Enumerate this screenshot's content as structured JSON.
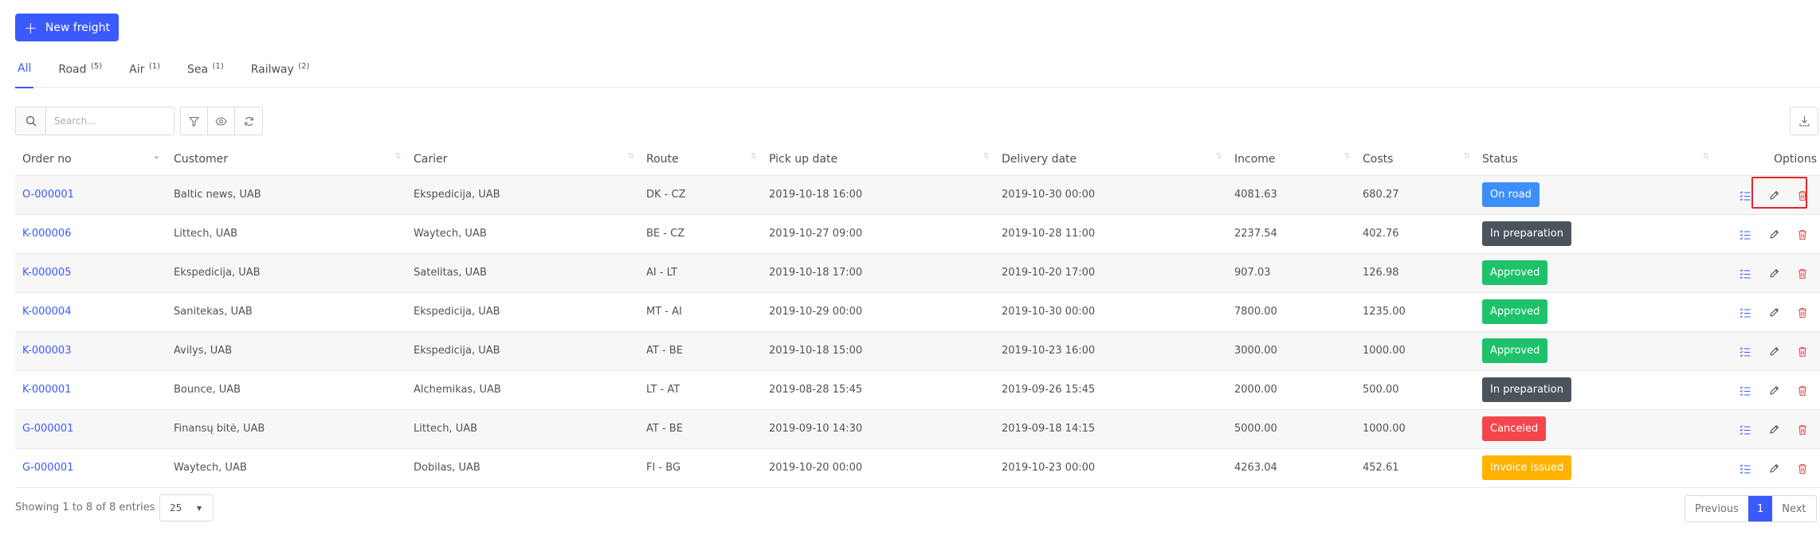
{
  "new_button": {
    "label": "New freight"
  },
  "tabs": [
    {
      "label": "All",
      "count": ""
    },
    {
      "label": "Road",
      "count": "(5)"
    },
    {
      "label": "Air",
      "count": "(1)"
    },
    {
      "label": "Sea",
      "count": "(1)"
    },
    {
      "label": "Railway",
      "count": "(2)"
    }
  ],
  "active_tab": "All",
  "search": {
    "placeholder": "Search...",
    "value": ""
  },
  "toolbar_icons": [
    "filter-icon",
    "eye-icon",
    "refresh-icon",
    "download-icon"
  ],
  "columns": [
    "Order no",
    "Customer",
    "Carier",
    "Route",
    "Pick up date",
    "Delivery date",
    "Income",
    "Costs",
    "Status",
    "Options"
  ],
  "rows": [
    {
      "order": "O-000001",
      "customer": "Baltic news, UAB",
      "carrier": "Ekspedicija, UAB",
      "route": "DK - CZ",
      "pickup": "2019-10-18 16:00",
      "delivery": "2019-10-30 00:00",
      "income": "4081.63",
      "costs": "680.27",
      "status": "On road",
      "status_color": "#3d8ef8"
    },
    {
      "order": "K-000006",
      "customer": "Littech, UAB",
      "carrier": "Waytech, UAB",
      "route": "BE - CZ",
      "pickup": "2019-10-27 09:00",
      "delivery": "2019-10-28 11:00",
      "income": "2237.54",
      "costs": "402.76",
      "status": "In preparation",
      "status_color": "#4b545c"
    },
    {
      "order": "K-000005",
      "customer": "Ekspedicija, UAB",
      "carrier": "Satelitas, UAB",
      "route": "AI - LT",
      "pickup": "2019-10-18 17:00",
      "delivery": "2019-10-20 17:00",
      "income": "907.03",
      "costs": "126.98",
      "status": "Approved",
      "status_color": "#1ec26a"
    },
    {
      "order": "K-000004",
      "customer": "Sanitekas, UAB",
      "carrier": "Ekspedicija, UAB",
      "route": "MT - AI",
      "pickup": "2019-10-29 00:00",
      "delivery": "2019-10-30 00:00",
      "income": "7800.00",
      "costs": "1235.00",
      "status": "Approved",
      "status_color": "#1ec26a"
    },
    {
      "order": "K-000003",
      "customer": "Avilys, UAB",
      "carrier": "Ekspedicija, UAB",
      "route": "AT - BE",
      "pickup": "2019-10-18 15:00",
      "delivery": "2019-10-23 16:00",
      "income": "3000.00",
      "costs": "1000.00",
      "status": "Approved",
      "status_color": "#1ec26a"
    },
    {
      "order": "K-000001",
      "customer": "Bounce, UAB",
      "carrier": "Alchemikas, UAB",
      "route": "LT - AT",
      "pickup": "2019-08-28 15:45",
      "delivery": "2019-09-26 15:45",
      "income": "2000.00",
      "costs": "500.00",
      "status": "In preparation",
      "status_color": "#4b545c"
    },
    {
      "order": "G-000001",
      "customer": "Finansų bitė, UAB",
      "carrier": "Littech, UAB",
      "route": "AT - BE",
      "pickup": "2019-09-10 14:30",
      "delivery": "2019-09-18 14:15",
      "income": "5000.00",
      "costs": "1000.00",
      "status": "Canceled",
      "status_color": "#f4474d"
    },
    {
      "order": "G-000001",
      "customer": "Waytech, UAB",
      "carrier": "Dobilas, UAB",
      "route": "FI - BG",
      "pickup": "2019-10-20 00:00",
      "delivery": "2019-10-23 00:00",
      "income": "4263.04",
      "costs": "452.61",
      "status": "Invoice issued",
      "status_color": "#ffb300"
    }
  ],
  "footer": {
    "info": "Showing 1 to 8 of 8 entries",
    "page_size": "25",
    "previous": "Previous",
    "current_page": "1",
    "next": "Next"
  },
  "colors": {
    "accent": "#3a5afe",
    "delete": "#f4474d",
    "highlight": "#e0272b"
  }
}
